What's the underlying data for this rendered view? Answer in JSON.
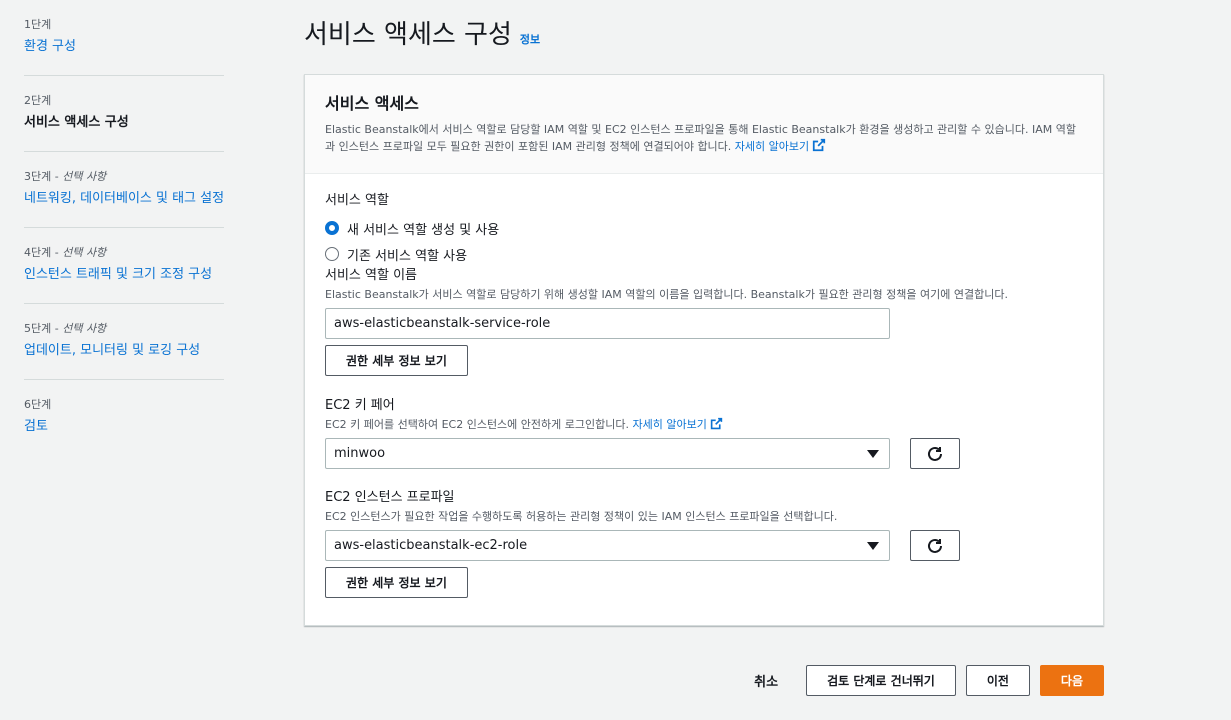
{
  "sidebar": {
    "steps": [
      {
        "label": "1단계",
        "optional": "",
        "title": "환경 구성"
      },
      {
        "label": "2단계",
        "optional": "",
        "title": "서비스 액세스 구성"
      },
      {
        "label": "3단계 - ",
        "optional": "선택 사항",
        "title": "네트워킹, 데이터베이스 및 태그 설정"
      },
      {
        "label": "4단계 - ",
        "optional": "선택 사항",
        "title": "인스턴스 트래픽 및 크기 조정 구성"
      },
      {
        "label": "5단계 - ",
        "optional": "선택 사항",
        "title": "업데이트, 모니터링 및 로깅 구성"
      },
      {
        "label": "6단계",
        "optional": "",
        "title": "검토"
      }
    ]
  },
  "header": {
    "title": "서비스 액세스 구성",
    "info": "정보"
  },
  "panel": {
    "title": "서비스 액세스",
    "description": "Elastic Beanstalk에서 서비스 역할로 담당할 IAM 역할 및 EC2 인스턴스 프로파일을 통해 Elastic Beanstalk가 환경을 생성하고 관리할 수 있습니다. IAM 역할과 인스턴스 프로파일 모두 필요한 권한이 포함된 IAM 관리형 정책에 연결되어야 합니다.",
    "learn_more": "자세히 알아보기",
    "service_role": {
      "label": "서비스 역할",
      "option_new": "새 서비스 역할 생성 및 사용",
      "option_existing": "기존 서비스 역할 사용"
    },
    "service_role_name": {
      "label": "서비스 역할 이름",
      "description": "Elastic Beanstalk가 서비스 역할로 담당하기 위해 생성할 IAM 역할의 이름을 입력합니다. Beanstalk가 필요한 관리형 정책을 여기에 연결합니다.",
      "value": "aws-elasticbeanstalk-service-role",
      "view_permissions": "권한 세부 정보 보기"
    },
    "ec2_key_pair": {
      "label": "EC2 키 페어",
      "description": "EC2 키 페어를 선택하여 EC2 인스턴스에 안전하게 로그인합니다.",
      "learn_more": "자세히 알아보기",
      "value": "minwoo"
    },
    "ec2_instance_profile": {
      "label": "EC2 인스턴스 프로파일",
      "description": "EC2 인스턴스가 필요한 작업을 수행하도록 허용하는 관리형 정책이 있는 IAM 인스턴스 프로파일을 선택합니다.",
      "value": "aws-elasticbeanstalk-ec2-role",
      "view_permissions": "권한 세부 정보 보기"
    }
  },
  "footer": {
    "cancel": "취소",
    "skip_to_review": "검토 단계로 건너뛰기",
    "previous": "이전",
    "next": "다음"
  },
  "colors": {
    "accent": "#0972d3",
    "primary_button": "#ec7211",
    "background": "#f2f3f3"
  }
}
